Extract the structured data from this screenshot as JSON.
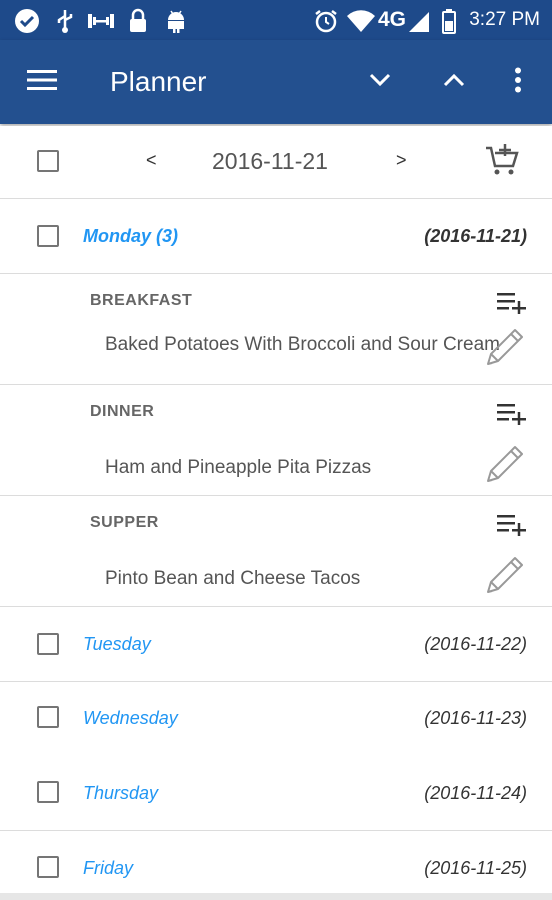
{
  "status_bar": {
    "time": "3:27 PM",
    "network": "4G",
    "icons": [
      "check-badge-icon",
      "usb-icon",
      "barbell-icon",
      "lock-icon",
      "android-icon",
      "alarm-icon",
      "wifi-icon",
      "signal-icon",
      "battery-icon"
    ]
  },
  "app_bar": {
    "title": "Planner",
    "icons": [
      "menu-icon",
      "chevron-down-icon",
      "chevron-up-icon",
      "more-vert-icon"
    ]
  },
  "date_nav": {
    "prev": "<",
    "date": "2016-11-21",
    "next": ">",
    "cart_icon": "cart-add-icon"
  },
  "days": [
    {
      "name": "Monday (3)",
      "date": "(2016-11-21)",
      "expanded": true,
      "meals": [
        {
          "label": "BREAKFAST",
          "item": "Baked Potatoes With Broccoli and Sour Cream"
        },
        {
          "label": "DINNER",
          "item": "Ham and Pineapple Pita Pizzas"
        },
        {
          "label": "SUPPER",
          "item": "Pinto Bean and Cheese Tacos"
        }
      ]
    },
    {
      "name": "Tuesday",
      "date": "(2016-11-22)"
    },
    {
      "name": "Wednesday",
      "date": "(2016-11-23)"
    },
    {
      "name": "Thursday",
      "date": "(2016-11-24)"
    },
    {
      "name": "Friday",
      "date": "(2016-11-25)"
    }
  ],
  "colors": {
    "app_bar": "#23508f",
    "status_bar": "#1e4a8a",
    "day_name": "#2196f3"
  }
}
